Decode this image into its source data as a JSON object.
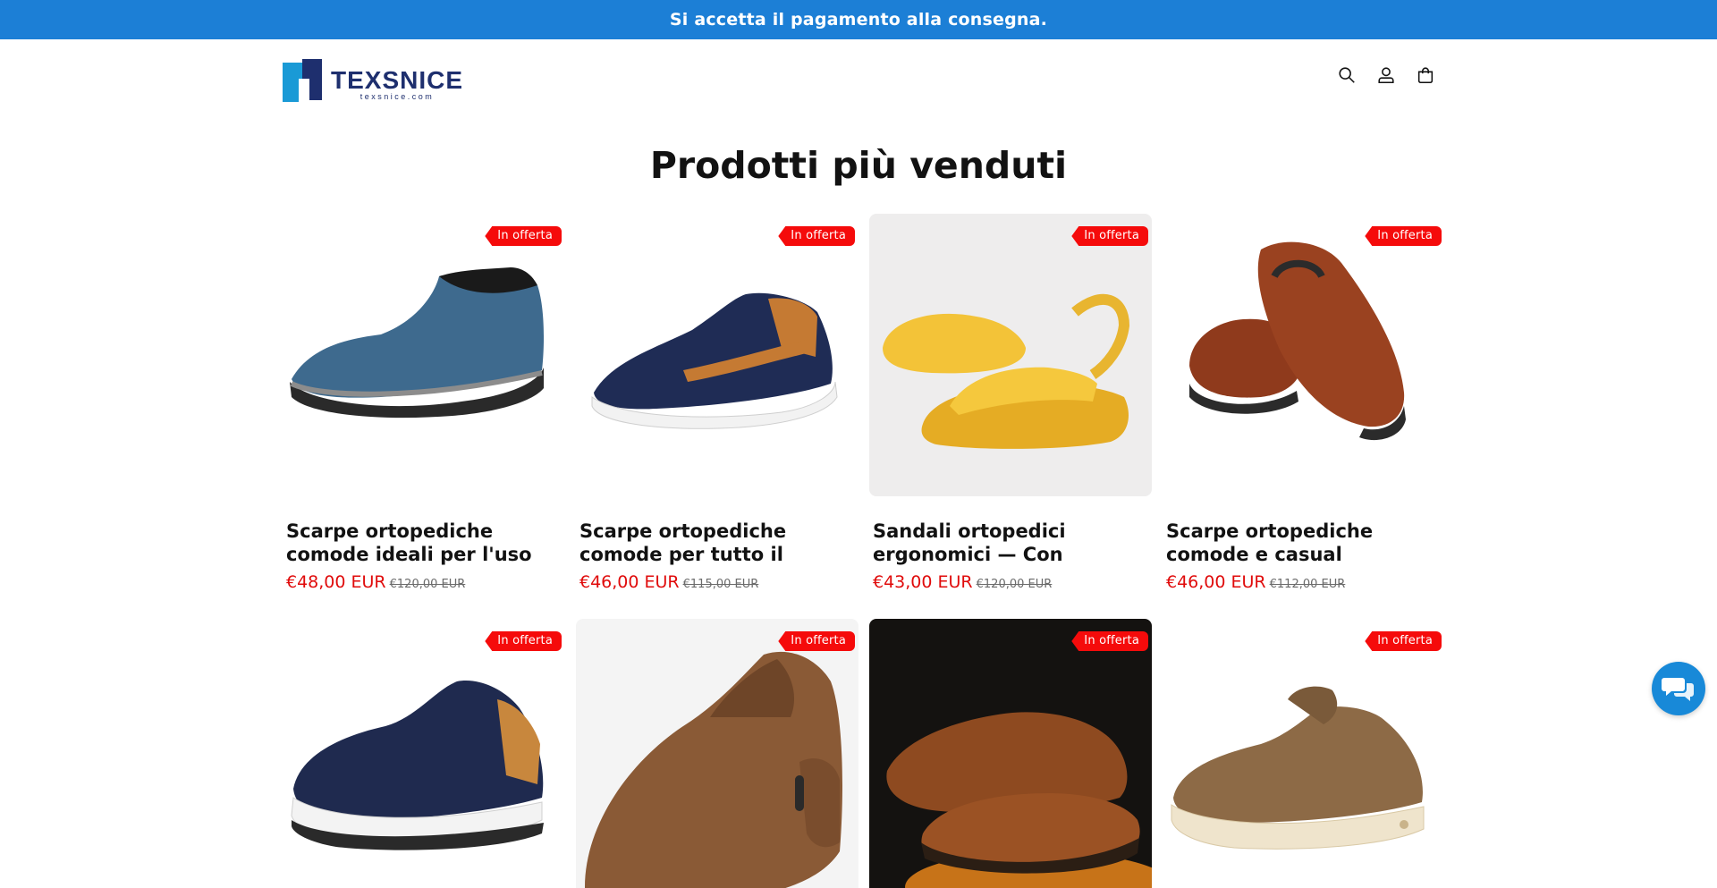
{
  "announcement": {
    "text": "Si accetta il pagamento alla consegna."
  },
  "header": {
    "logo_name": "TEXSNICE",
    "logo_url": "texsnice.com",
    "icons": [
      "search-icon",
      "account-icon",
      "cart-icon"
    ]
  },
  "section": {
    "title": "Prodotti più venduti"
  },
  "products": [
    {
      "title": "Scarpe ortopediche comode ideali per l'uso quotidiano",
      "price": "€48,00 EUR",
      "compare_price": "€120,00 EUR",
      "badge": "In offerta"
    },
    {
      "title": "Scarpe ortopediche comode per tutto il giorno",
      "price": "€46,00 EUR",
      "compare_price": "€115,00 EUR",
      "badge": "In offerta"
    },
    {
      "title": "Sandali ortopedici ergonomici — Con suppor…",
      "price": "€43,00 EUR",
      "compare_price": "€120,00 EUR",
      "badge": "In offerta"
    },
    {
      "title": "Scarpe ortopediche comode e casual",
      "price": "€46,00 EUR",
      "compare_price": "€112,00 EUR",
      "badge": "In offerta"
    },
    {
      "badge": "In offerta"
    },
    {
      "badge": "In offerta"
    },
    {
      "badge": "In offerta"
    },
    {
      "badge": "In offerta"
    }
  ],
  "colors": {
    "announcement_bg": "#1c7fd6",
    "sale_red": "#e00b0b",
    "badge_red": "#f50b0b",
    "brand_dark": "#1e2f6e",
    "brand_light": "#1a9ad6",
    "chat_bg": "#1889d8"
  },
  "chat": {
    "icon": "chat-bubbles-icon"
  }
}
